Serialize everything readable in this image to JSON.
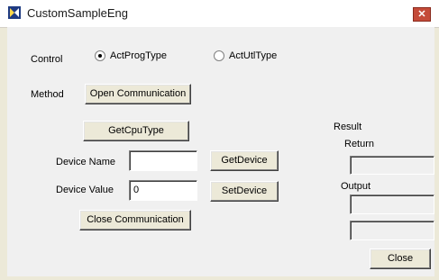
{
  "window": {
    "title": "CustomSampleEng",
    "close_glyph": "✕"
  },
  "control": {
    "label": "Control",
    "options": [
      {
        "label": "ActProgType",
        "selected": true
      },
      {
        "label": "ActUtlType",
        "selected": false
      }
    ]
  },
  "method": {
    "label": "Method",
    "open_button": "Open Communication",
    "cpu_button": "GetCpuType",
    "close_comm_button": "Close  Communication"
  },
  "device": {
    "name_label": "Device Name",
    "name_value": "",
    "get_button": "GetDevice",
    "value_label": "Device Value",
    "value_value": "0",
    "set_button": "SetDevice"
  },
  "result": {
    "label": "Result",
    "return_label": "Return",
    "return_value": "",
    "output_label": "Output",
    "output_value_1": "",
    "output_value_2": ""
  },
  "footer": {
    "close_button": "Close"
  },
  "icons": {
    "app": "app-icon",
    "close": "close-icon"
  }
}
